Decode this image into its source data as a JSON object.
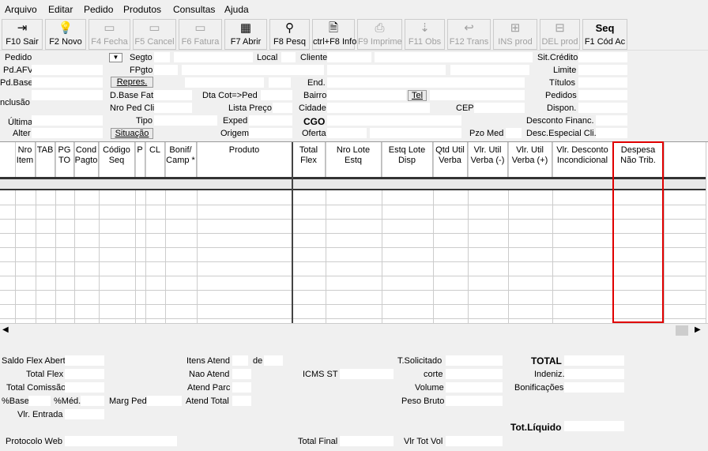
{
  "menu": [
    "Arquivo",
    "Editar",
    "Pedido",
    "Produtos",
    "Consultas",
    "Ajuda"
  ],
  "toolbar": [
    {
      "label": "F10 Sair",
      "icon": "exit-icon",
      "glyph": "⇥",
      "enabled": true
    },
    {
      "label": "F2 Novo",
      "icon": "lightbulb-icon",
      "glyph": "💡",
      "enabled": true
    },
    {
      "label": "F4 Fecha",
      "icon": "close-doc-icon",
      "glyph": "▭",
      "enabled": false
    },
    {
      "label": "F5 Cancel",
      "icon": "cancel-icon",
      "glyph": "▭",
      "enabled": false
    },
    {
      "label": "F6 Fatura",
      "icon": "invoice-icon",
      "glyph": "▭",
      "enabled": false
    },
    {
      "label": "F7 Abrir",
      "icon": "open-icon",
      "glyph": "▦",
      "enabled": true
    },
    {
      "label": "F8 Pesq",
      "icon": "binoculars-icon",
      "glyph": "⚲",
      "enabled": true
    },
    {
      "label": "ctrl+F8 Info",
      "icon": "info-icon",
      "glyph": "🗎",
      "enabled": true
    },
    {
      "label": "F9 Imprime",
      "icon": "print-icon",
      "glyph": "⎙",
      "enabled": false
    },
    {
      "label": "F11 Obs",
      "icon": "obs-icon",
      "glyph": "⇣",
      "enabled": false
    },
    {
      "label": "F12 Trans",
      "icon": "trans-icon",
      "glyph": "↩",
      "enabled": false
    },
    {
      "label": "INS prod",
      "icon": "insert-icon",
      "glyph": "⊞",
      "enabled": false
    },
    {
      "label": "DEL prod",
      "icon": "delete-icon",
      "glyph": "⊟",
      "enabled": false
    },
    {
      "label": "F1 Cód Ac",
      "icon": "seq-icon",
      "glyph": "Seq",
      "enabled": true
    }
  ],
  "header": {
    "pedido": "Pedido",
    "segto": "Segto",
    "local": "Local",
    "cliente": "Cliente",
    "sit_credito": "Sit.Crédito",
    "pd_afv": "Pd.AFV",
    "fpgto": "FPgto",
    "limite": "Limite",
    "pd_base": "Pd.Base",
    "repres": "Repres.",
    "end": "End.",
    "titulos": "Títulos",
    "inclusao": "nclusão",
    "dbase_fat": "D.Base Fat",
    "dta_cot": "Dta Cot=>Ped",
    "bairro": "Bairro",
    "tel": "Tel",
    "pedidos": "Pedidos",
    "nro_ped_cli": "Nro Ped Cli",
    "lista_preco": "Lista Preço",
    "cidade": "Cidade",
    "cep": "CEP",
    "dispon": "Dispon.",
    "ultima": "Última",
    "tipo": "Tipo",
    "exped": "Exped",
    "cgo": "CGO",
    "desconto_financ": "Desconto Financ.",
    "alter": "Alter",
    "situacao": "Situação",
    "origem": "Origem",
    "oferta": "Oferta",
    "pzo_med": "Pzo Med",
    "desc_especial": "Desc.Especial Cli."
  },
  "columns": [
    {
      "name": "col-nro-item",
      "text": "Nro\nItem"
    },
    {
      "name": "col-tab",
      "text": "TAB"
    },
    {
      "name": "col-pgto",
      "text": "PG\nTO"
    },
    {
      "name": "col-cond-pagto",
      "text": "Cond\nPagto"
    },
    {
      "name": "col-codigo-seq",
      "text": "Código\nSeq"
    },
    {
      "name": "col-p",
      "text": "P"
    },
    {
      "name": "col-cl",
      "text": "CL"
    },
    {
      "name": "col-bonif-camp",
      "text": "Bonif/\nCamp *"
    },
    {
      "name": "col-produto",
      "text": "Produto"
    },
    {
      "name": "col-total-flex",
      "text": "Total\nFlex"
    },
    {
      "name": "col-nro-lote-estq",
      "text": "Nro Lote\nEstq"
    },
    {
      "name": "col-estq-lote-disp",
      "text": "Estq Lote\nDisp"
    },
    {
      "name": "col-qtd-util-verba",
      "text": "Qtd Util\nVerba"
    },
    {
      "name": "col-vlr-util-verba-minus",
      "text": "Vlr. Util\nVerba (-)"
    },
    {
      "name": "col-vlr-util-verba-plus",
      "text": "Vlr. Util\nVerba (+)"
    },
    {
      "name": "col-vlr-desconto-incondicional",
      "text": "Vlr. Desconto\nIncondicional"
    },
    {
      "name": "col-despesa-nao-trib",
      "text": "Despesa\nNão Trib."
    }
  ],
  "footer": {
    "saldo_flex_abert": "Saldo Flex Abert",
    "total_flex": "Total Flex",
    "total_comissao": "Total Comissão",
    "pct_base": "%Base",
    "pct_med": "%Méd.",
    "marg_ped": "Marg Ped",
    "vlr_entrada": "Vlr. Entrada",
    "itens_atend": "Itens Atend",
    "de": "de",
    "nao_atend": "Nao Atend",
    "icms_st": "ICMS ST",
    "atend_parc": "Atend Parc",
    "atend_total": "Atend Total",
    "t_solicitado": "T.Solicitado",
    "corte": "corte",
    "volume": "Volume",
    "peso_bruto": "Peso Bruto",
    "total": "TOTAL",
    "indeniz": "Indeniz.",
    "bonificacoes": "Bonificações",
    "tot_liquido": "Tot.Líquido",
    "protocolo_web": "Protocolo Web",
    "total_final": "Total Final",
    "vlr_tot_vol": "Vlr Tot Vol"
  }
}
